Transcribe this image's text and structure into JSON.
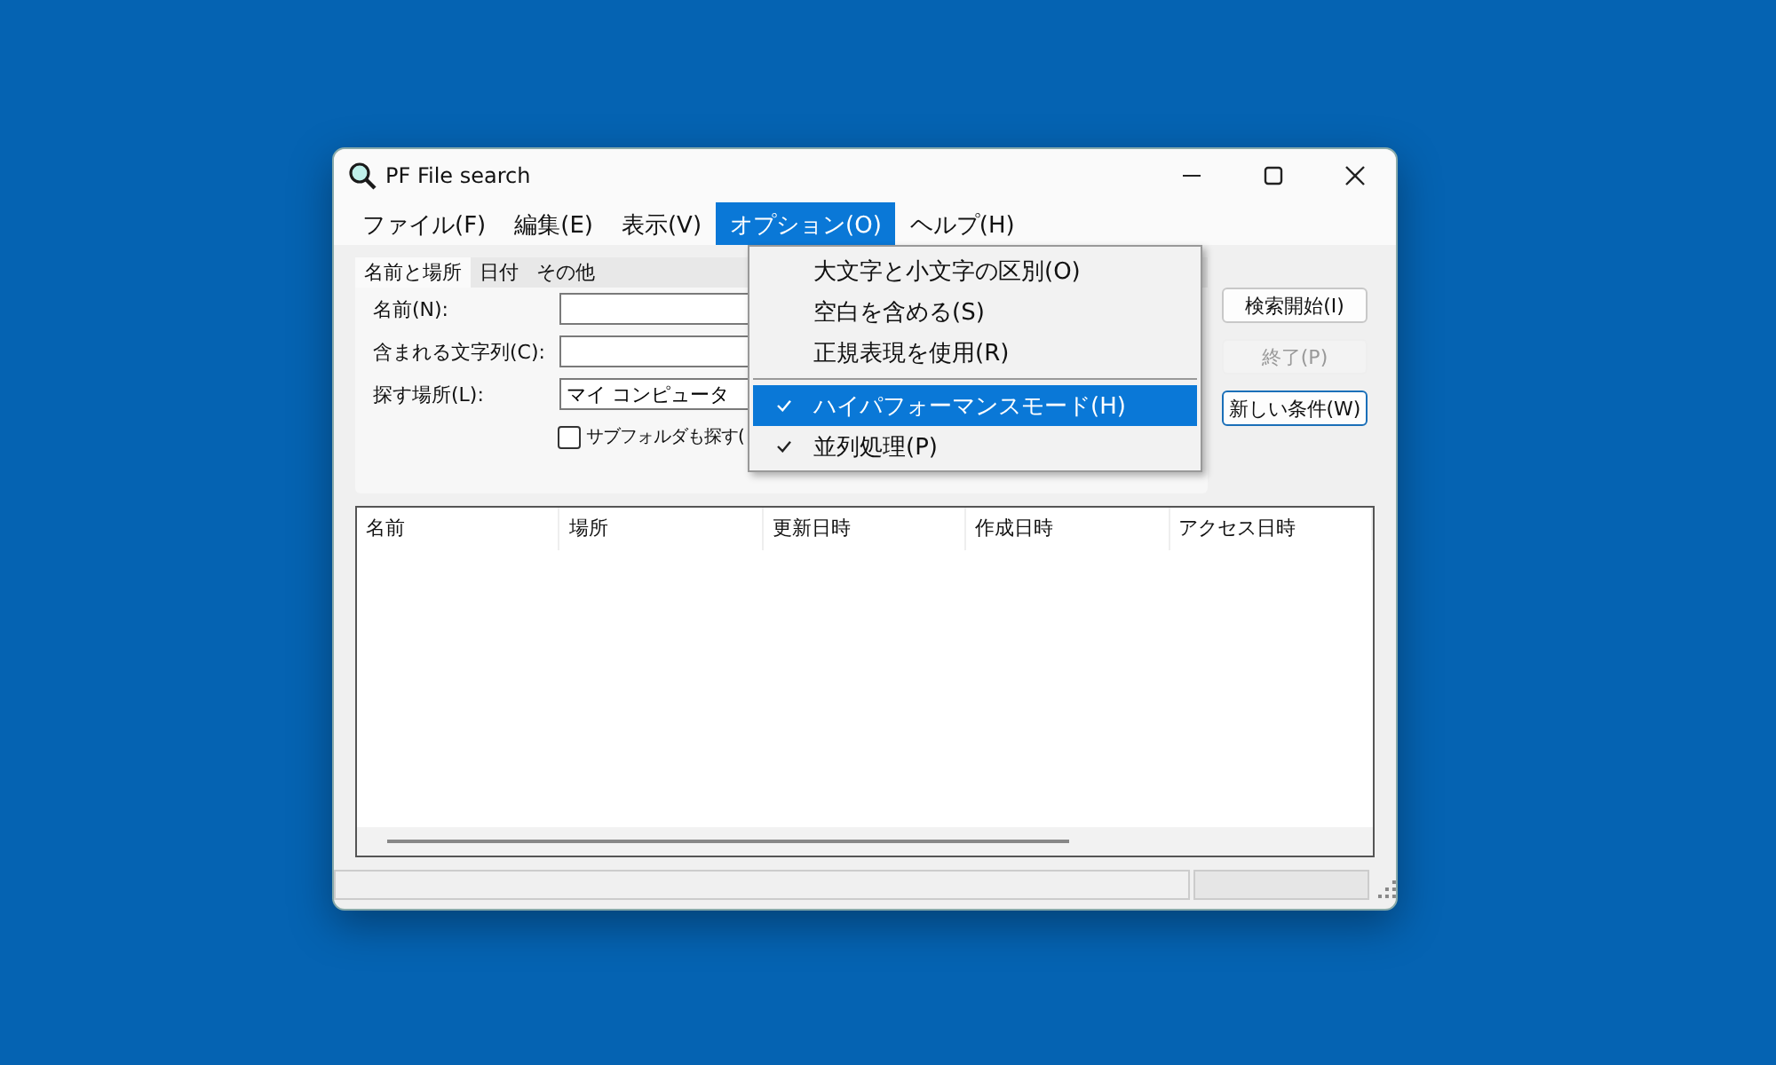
{
  "window": {
    "title": "PF File search"
  },
  "menu_bar": [
    {
      "label": "ファイル(F)",
      "selected": false
    },
    {
      "label": "編集(E)",
      "selected": false
    },
    {
      "label": "表示(V)",
      "selected": false
    },
    {
      "label": "オプション(O)",
      "selected": true
    },
    {
      "label": "ヘルプ(H)",
      "selected": false
    }
  ],
  "tabs": [
    {
      "label": "名前と場所",
      "selected": true
    },
    {
      "label": "日付",
      "selected": false
    },
    {
      "label": "その他",
      "selected": false
    }
  ],
  "fields": [
    {
      "label": "名前(N):"
    },
    {
      "label": "含まれる文字列(C):"
    },
    {
      "label": "探す場所(L):",
      "value": "マイ コンピュータ"
    }
  ],
  "subfolder_checkbox": {
    "label": "サブフォルダも探す(",
    "checked": false
  },
  "buttons": [
    {
      "label": "検索開始(I)",
      "disabled": false,
      "focused": false
    },
    {
      "label": "終了(P)",
      "disabled": true,
      "focused": false
    },
    {
      "label": "新しい条件(W)",
      "disabled": false,
      "focused": true
    }
  ],
  "table": {
    "columns": [
      "名前",
      "場所",
      "更新日時",
      "作成日時",
      "アクセス日時"
    ]
  },
  "options_menu": [
    {
      "kind": "item",
      "label": "大文字と小文字の区別(O)",
      "checked": false,
      "selected": false
    },
    {
      "kind": "item",
      "label": "空白を含める(S)",
      "checked": false,
      "selected": false
    },
    {
      "kind": "item",
      "label": "正規表現を使用(R)",
      "checked": false,
      "selected": false
    },
    {
      "kind": "separator"
    },
    {
      "kind": "item",
      "label": "ハイパフォーマンスモード(H)",
      "checked": true,
      "selected": true
    },
    {
      "kind": "item",
      "label": "並列処理(P)",
      "checked": true,
      "selected": false
    }
  ]
}
